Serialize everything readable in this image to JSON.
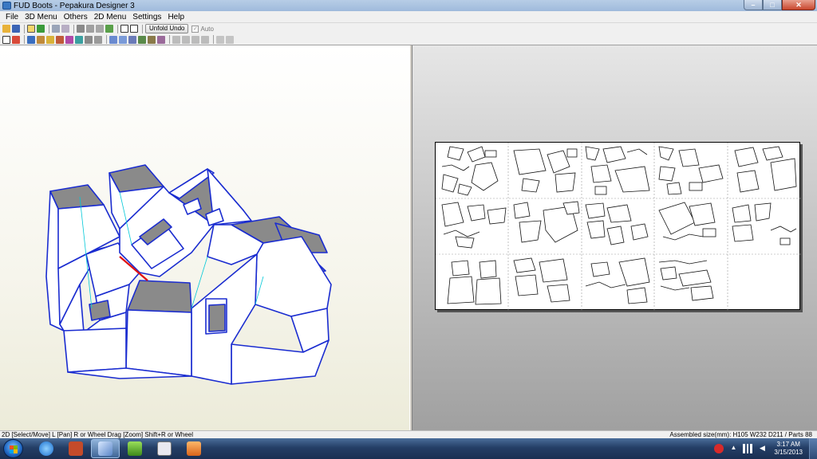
{
  "window": {
    "title": "FUD Boots - Pepakura Designer 3",
    "buttons": {
      "minimize": "–",
      "maximize": "□",
      "close": "✕"
    }
  },
  "menu": [
    "File",
    "3D Menu",
    "Others",
    "2D Menu",
    "Settings",
    "Help"
  ],
  "toolbar": {
    "unfold_undo": "Unfold Undo",
    "auto_label": "Auto",
    "auto_checked": true
  },
  "status": {
    "left": "2D [Select/Move] L [Pan] R or Wheel Drag [Zoom] Shift+R or Wheel",
    "right": "Assembled size(mm): H105 W232 D211 / Parts 88"
  },
  "taskbar": {
    "time": "3:17 AM",
    "date": "3/15/2013",
    "apps": [
      "internet-explorer",
      "pepakura-viewer",
      "pepakura-designer",
      "notepad-plus",
      "media-app",
      "paint-app"
    ]
  },
  "colors": {
    "model_edge": "#1a2cd0",
    "model_face": "#ffffff",
    "model_shadow": "#8a8a8a",
    "cut_line": "#e01010"
  }
}
